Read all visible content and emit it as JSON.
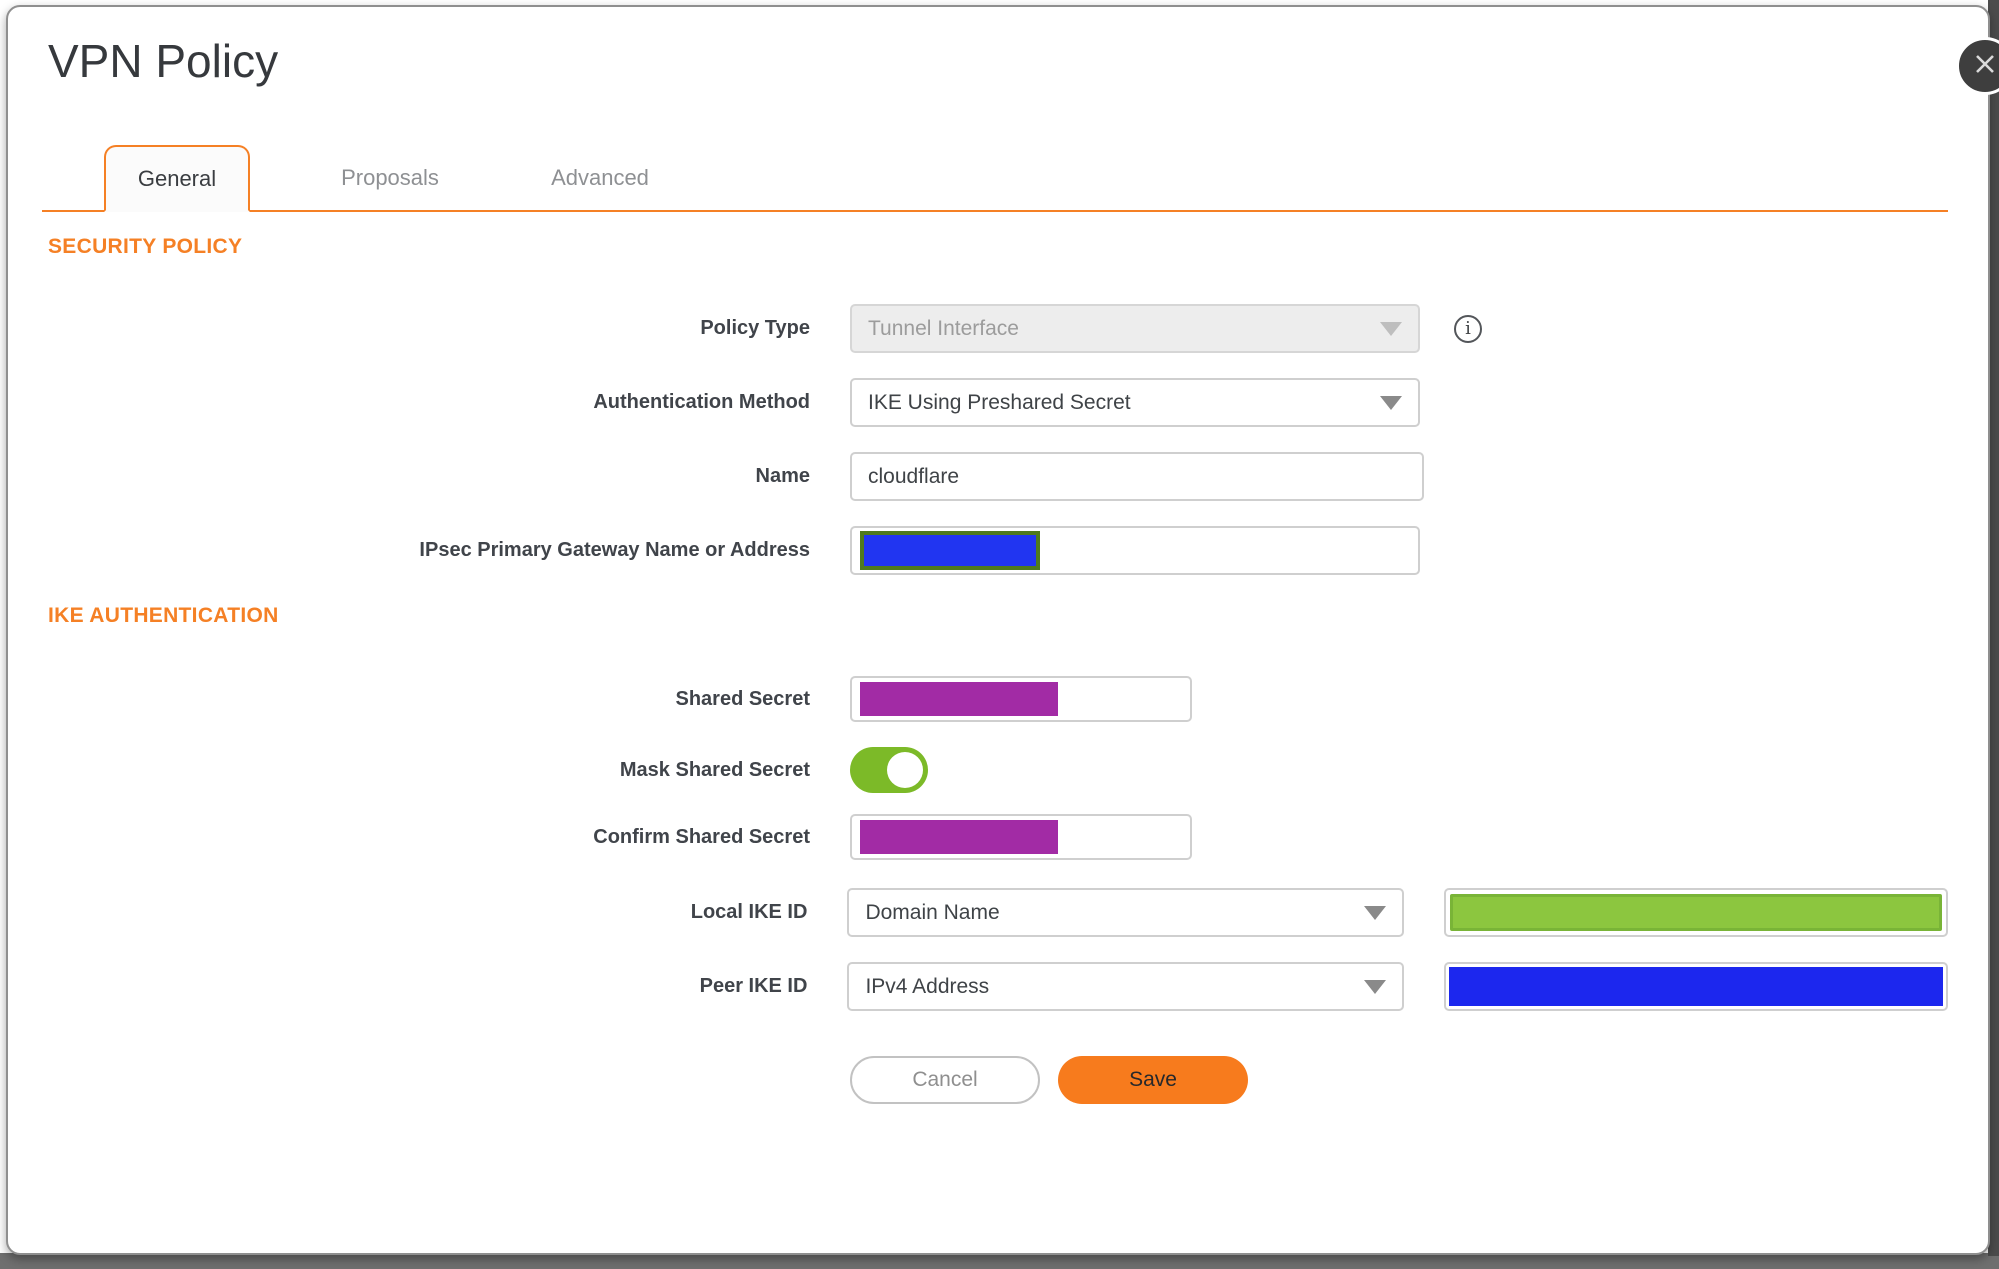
{
  "dialog": {
    "title": "VPN Policy"
  },
  "tabs": [
    {
      "label": "General",
      "active": true
    },
    {
      "label": "Proposals",
      "active": false
    },
    {
      "label": "Advanced",
      "active": false
    }
  ],
  "security_policy": {
    "heading": "SECURITY POLICY",
    "fields": [
      {
        "label": "Policy Type",
        "value": "Tunnel Interface",
        "disabled": true,
        "info_icon": "i"
      },
      {
        "label": "Authentication Method",
        "value": "IKE Using Preshared Secret"
      },
      {
        "label": "Name",
        "value": "cloudflare"
      },
      {
        "label": "IPsec Primary Gateway Name or Address",
        "value": "",
        "redaction": "blue-with-green-border"
      }
    ]
  },
  "ike_authentication": {
    "heading": "IKE AUTHENTICATION",
    "fields": [
      {
        "label": "Shared Secret",
        "redaction": "purple"
      },
      {
        "label": "Mask Shared Secret",
        "toggle_state": "on"
      },
      {
        "label": "Confirm Shared Secret",
        "redaction": "purple"
      },
      {
        "label": "Local IKE ID",
        "value": "Domain Name",
        "extra_redaction": "green"
      },
      {
        "label": "Peer IKE ID",
        "value": "IPv4 Address",
        "extra_redaction": "blue"
      }
    ]
  },
  "buttons": {
    "cancel": "Cancel",
    "save": "Save"
  },
  "colors": {
    "accent_orange": "#F58025",
    "save_button_orange": "#F77B1D",
    "toggle_green": "#7CBA28",
    "redaction_purple": "#A22BA5",
    "redaction_blue": "#1C27EE",
    "gateway_redaction_blue": "#2135F1",
    "gateway_redaction_border": "#4F7A1D",
    "redaction_green": "#8CC63F"
  }
}
